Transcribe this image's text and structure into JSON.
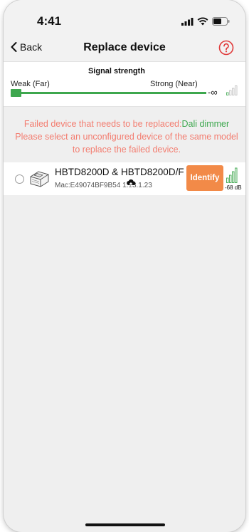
{
  "status_bar": {
    "time": "4:41"
  },
  "nav": {
    "back_label": "Back",
    "title": "Replace device",
    "help_icon": "question-circle-icon"
  },
  "signal_strength": {
    "title": "Signal strength",
    "weak_label": "Weak (Far)",
    "strong_label": "Strong (Near)",
    "min_symbol": "-∞",
    "slider_level": 0
  },
  "message": {
    "prefix": "Failed device that needs to be replaced:",
    "device_name": "Dali dimmer",
    "instruction": "Please select an unconfigured device of the same model to replace the failed device."
  },
  "devices": [
    {
      "name": "HBTD8200D & HBTD8200D/F",
      "mac": "Mac:E49074BF9B54",
      "version": "1.13.1.23",
      "identify_label": "Identify",
      "rssi": "-68 dB",
      "selected": false
    }
  ],
  "colors": {
    "accent_green": "#3da74e",
    "warning_text": "#f37d70",
    "identify_button": "#f28a48",
    "help_icon_red": "#e03a3a"
  }
}
